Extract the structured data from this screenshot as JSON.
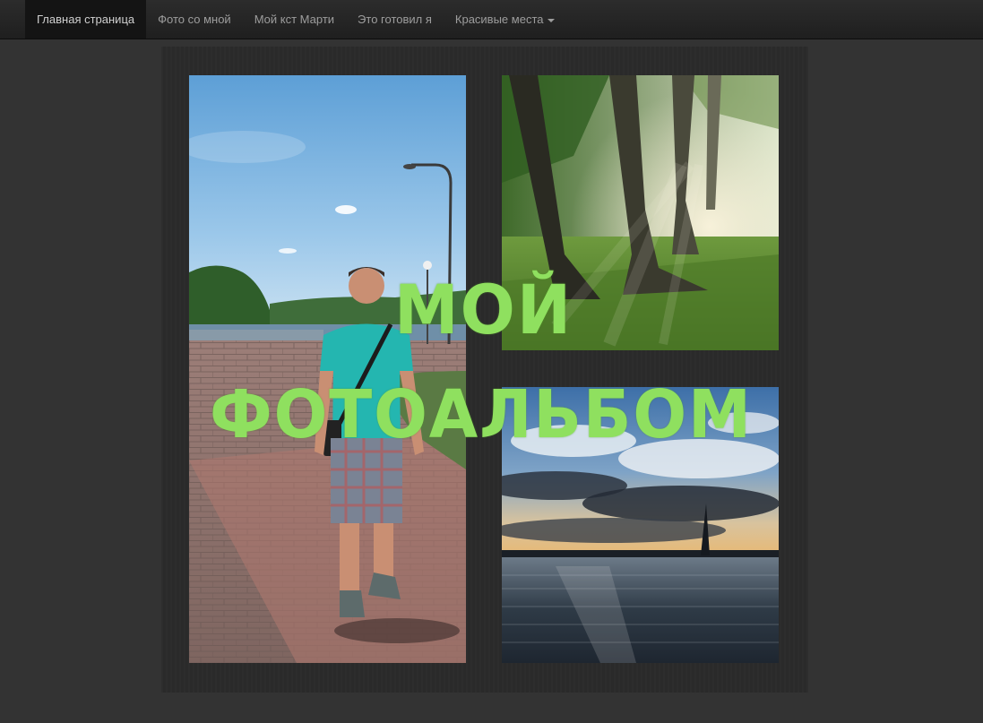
{
  "nav": {
    "items": [
      {
        "label": "Главная страница",
        "active": true
      },
      {
        "label": "Фото со мной",
        "active": false
      },
      {
        "label": "Мой кст Марти",
        "active": false
      },
      {
        "label": "Это готовил я",
        "active": false
      },
      {
        "label": "Красивые места",
        "active": false,
        "dropdown": true
      }
    ]
  },
  "hero": {
    "title_line1": "МОЙ",
    "title_line2": "ФОТОАЛЬБОМ",
    "title_color": "#8fe05f"
  },
  "colors": {
    "page_background": "#333333",
    "navbar_background": "#222222",
    "active_nav_background": "#141414"
  }
}
